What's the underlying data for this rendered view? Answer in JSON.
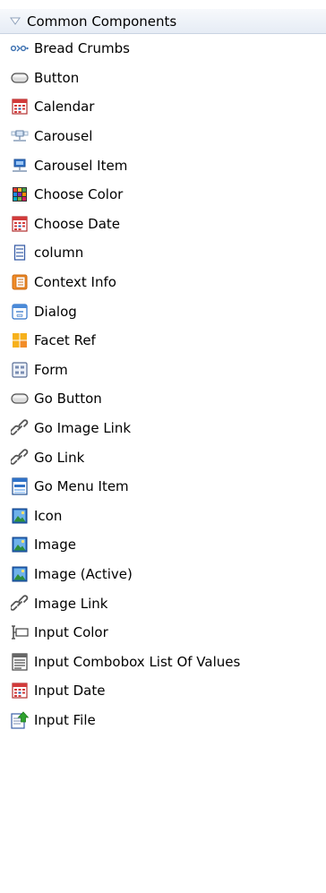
{
  "palette": {
    "section_title": "Common Components",
    "items": [
      {
        "label": "Bread Crumbs",
        "icon": "breadcrumbs-icon"
      },
      {
        "label": "Button",
        "icon": "button-icon"
      },
      {
        "label": "Calendar",
        "icon": "calendar-icon"
      },
      {
        "label": "Carousel",
        "icon": "carousel-icon"
      },
      {
        "label": "Carousel Item",
        "icon": "carousel-item-icon"
      },
      {
        "label": "Choose Color",
        "icon": "color-grid-icon"
      },
      {
        "label": "Choose Date",
        "icon": "calendar-icon"
      },
      {
        "label": "column",
        "icon": "column-icon"
      },
      {
        "label": "Context Info",
        "icon": "context-info-icon"
      },
      {
        "label": "Dialog",
        "icon": "dialog-icon"
      },
      {
        "label": "Facet Ref",
        "icon": "facet-ref-icon"
      },
      {
        "label": "Form",
        "icon": "form-icon"
      },
      {
        "label": "Go Button",
        "icon": "button-icon"
      },
      {
        "label": "Go Image Link",
        "icon": "link-icon"
      },
      {
        "label": "Go Link",
        "icon": "link-icon"
      },
      {
        "label": "Go Menu Item",
        "icon": "menu-item-icon"
      },
      {
        "label": "Icon",
        "icon": "image-icon"
      },
      {
        "label": "Image",
        "icon": "image-icon"
      },
      {
        "label": "Image (Active)",
        "icon": "image-icon"
      },
      {
        "label": "Image Link",
        "icon": "link-icon"
      },
      {
        "label": "Input Color",
        "icon": "input-color-icon"
      },
      {
        "label": "Input Combobox List Of Values",
        "icon": "combobox-icon"
      },
      {
        "label": "Input Date",
        "icon": "calendar-icon"
      },
      {
        "label": "Input File",
        "icon": "input-file-icon"
      }
    ]
  },
  "colors": {
    "header_bg": "#e6ecf5",
    "calendar_red": "#d23a3a",
    "image_blue": "#2f72c8",
    "upload_green": "#2fa32f"
  }
}
